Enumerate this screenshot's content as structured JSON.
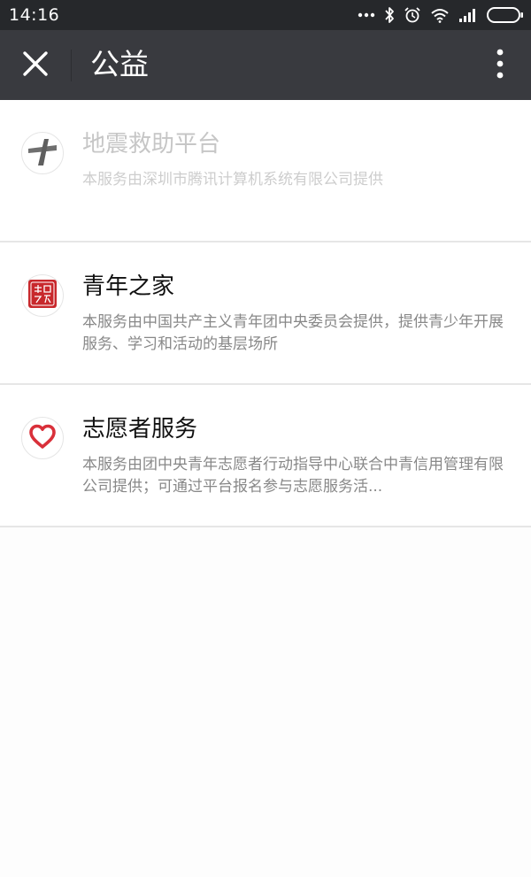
{
  "status_bar": {
    "time": "14:16",
    "icons": [
      "more-dots-icon",
      "bluetooth-icon",
      "alarm-icon",
      "wifi-icon",
      "signal-icon",
      "battery-icon"
    ]
  },
  "title_bar": {
    "title": "公益",
    "close_icon": "close-icon",
    "more_icon": "more-vertical-icon"
  },
  "services": [
    {
      "name": "地震救助平台",
      "description": "本服务由深圳市腾讯计算机系统有限公司提供",
      "logo_icon": "earthquake-relief-icon",
      "disabled": true
    },
    {
      "name": "青年之家",
      "description": "本服务由中国共产主义青年团中央委员会提供，提供青少年开展服务、学习和活动的基层场所",
      "logo_icon": "youth-home-icon",
      "logo_text": "青年之家",
      "disabled": false
    },
    {
      "name": "志愿者服务",
      "description": "本服务由团中央青年志愿者行动指导中心联合中青信用管理有限公司提供；可通过平台报名参与志愿服务活...",
      "logo_icon": "heart-icon",
      "disabled": false
    }
  ],
  "colors": {
    "status_bar_bg": "#26282b",
    "title_bar_bg": "#393a3f",
    "heart_red": "#d9303a",
    "youth_red": "#c8282c"
  }
}
